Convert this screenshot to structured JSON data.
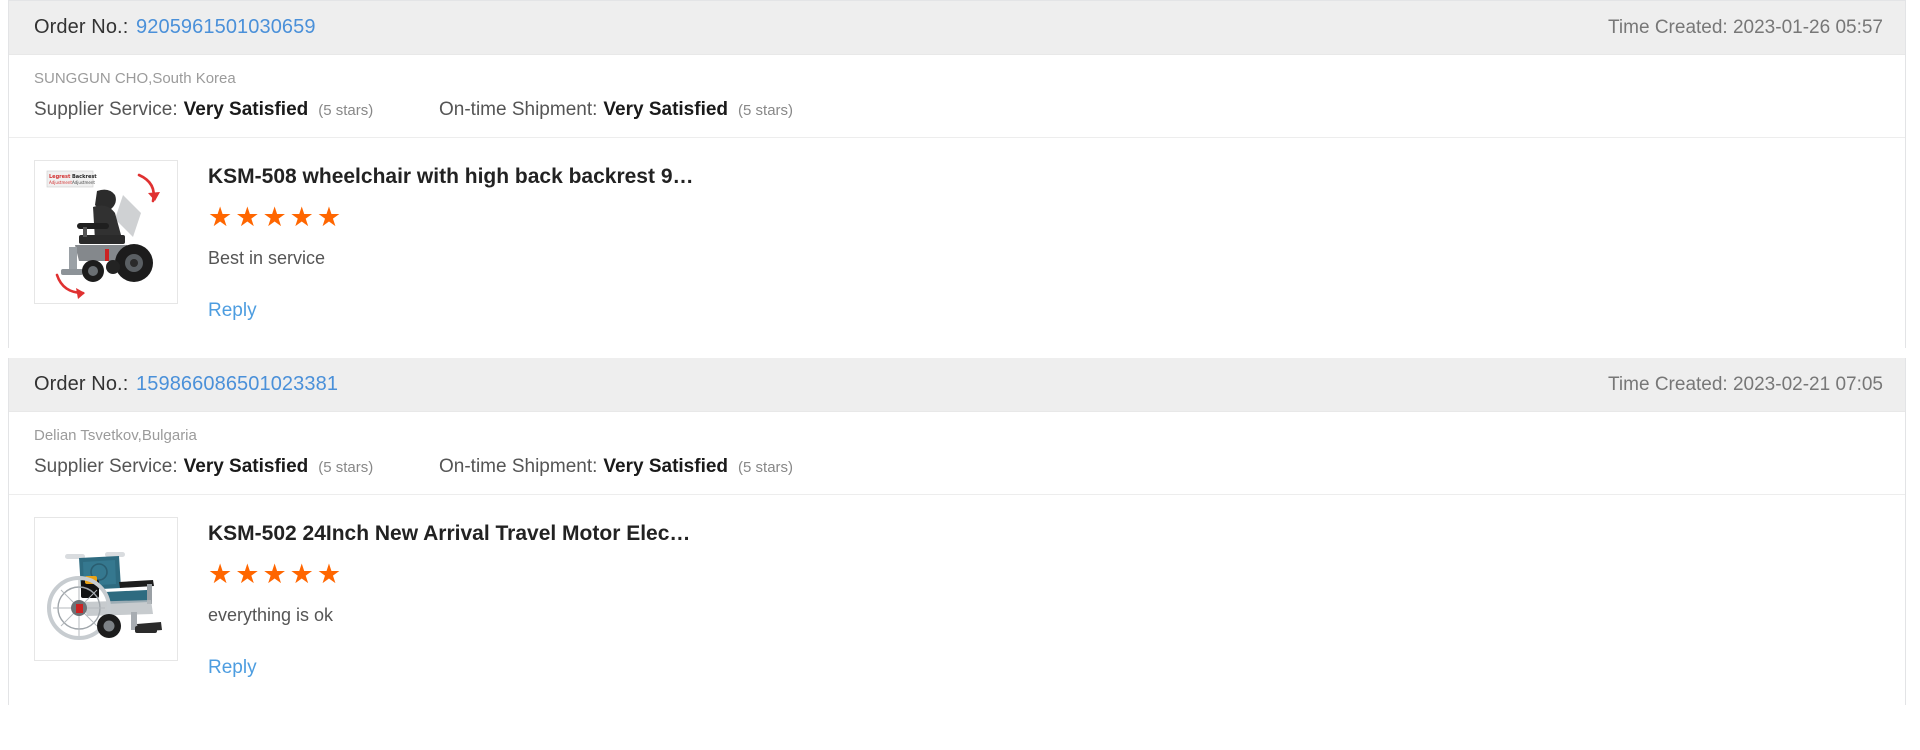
{
  "colors": {
    "link": "#4a90d9",
    "star": "#ff6600",
    "header_band": "#eeeeee",
    "reply_link": "#4d9de0",
    "border": "#e3e4e6"
  },
  "labels": {
    "order_no": "Order No.:",
    "time_created": "Time Created:",
    "supplier_service": "Supplier Service:",
    "on_time_shipment": "On-time Shipment:",
    "reply": "Reply"
  },
  "reviews": [
    {
      "order_no": "9205961501030659",
      "time_created": "2023-01-26 05:57",
      "buyer": "SUNGGUN CHO,South Korea",
      "supplier_service_value": "Very Satisfied",
      "supplier_service_stars": "(5 stars)",
      "on_time_shipment_value": "Very Satisfied",
      "on_time_shipment_stars": "(5 stars)",
      "product_title": "KSM-508 wheelchair with high back backrest 9…",
      "rating": 5,
      "comment": "Best in service",
      "reply": "Reply",
      "thumbnail": "reclining-electric-wheelchair-thumbnail"
    },
    {
      "order_no": "159866086501023381",
      "time_created": "2023-02-21 07:05",
      "buyer": "Delian Tsvetkov,Bulgaria",
      "supplier_service_value": "Very Satisfied",
      "supplier_service_stars": "(5 stars)",
      "on_time_shipment_value": "Very Satisfied",
      "on_time_shipment_stars": "(5 stars)",
      "product_title": "KSM-502 24Inch New Arrival Travel Motor Elec…",
      "rating": 5,
      "comment": "everything is ok",
      "reply": "Reply",
      "thumbnail": "blue-folding-wheelchair-thumbnail"
    }
  ]
}
